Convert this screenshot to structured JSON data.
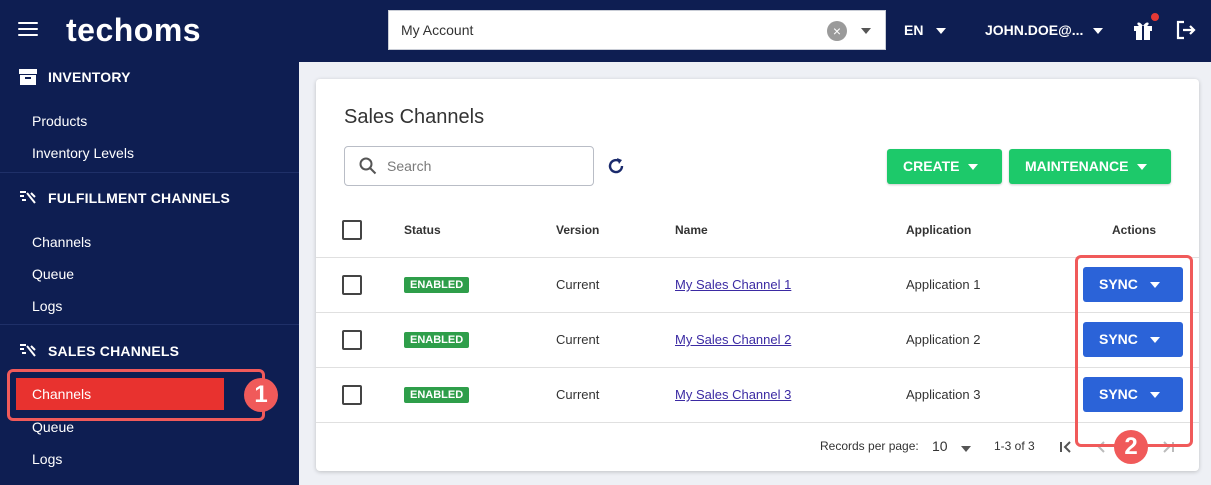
{
  "header": {
    "logo": "techoms",
    "account_value": "My Account",
    "language": "EN",
    "user": "JOHN.DOE@..."
  },
  "sidebar": {
    "inventory_title": "INVENTORY",
    "inventory_items": [
      "Products",
      "Inventory Levels"
    ],
    "fulfillment_title": "FULFILLMENT CHANNELS",
    "fulfillment_items": [
      "Channels",
      "Queue",
      "Logs"
    ],
    "sales_title": "SALES CHANNELS",
    "sales_items": [
      "Channels",
      "Queue",
      "Logs"
    ],
    "active_item": "Channels"
  },
  "callouts": [
    "1",
    "2"
  ],
  "main": {
    "title": "Sales Channels",
    "search_placeholder": "Search",
    "create_label": "CREATE",
    "maintenance_label": "MAINTENANCE",
    "columns": [
      "Status",
      "Version",
      "Name",
      "Application",
      "Actions"
    ],
    "rows": [
      {
        "status": "ENABLED",
        "version": "Current",
        "name": "My Sales Channel 1",
        "application": "Application 1",
        "action": "SYNC"
      },
      {
        "status": "ENABLED",
        "version": "Current",
        "name": "My Sales Channel 2",
        "application": "Application 2",
        "action": "SYNC"
      },
      {
        "status": "ENABLED",
        "version": "Current",
        "name": "My Sales Channel 3",
        "application": "Application 3",
        "action": "SYNC"
      }
    ],
    "pagination": {
      "records_label": "Records per page:",
      "per_page": "10",
      "range": "1-3 of 3"
    }
  },
  "colors": {
    "navy": "#0e1e52",
    "green": "#1dc96a",
    "blue": "#2b63d8",
    "highlight": "#f05a5a",
    "active": "#e8322f"
  }
}
